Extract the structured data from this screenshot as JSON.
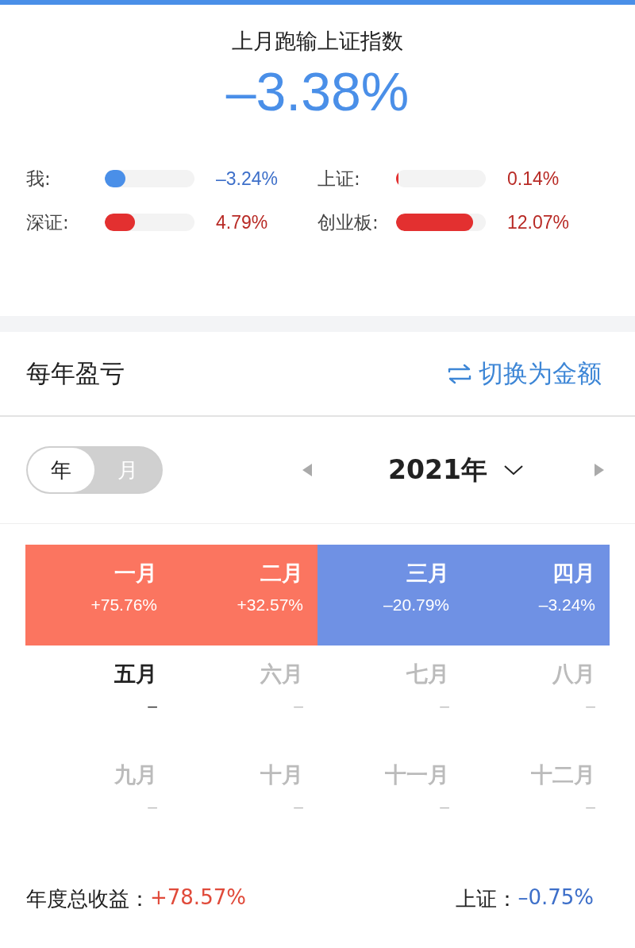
{
  "summary": {
    "title": "上月跑输上证指数",
    "value": "–3.38%"
  },
  "comparisons": [
    {
      "label": "我:",
      "level": 0.23,
      "color": "#4a8fe8",
      "reading": "–3.24%",
      "kind": "loss"
    },
    {
      "label": "上证:",
      "level": 0.02,
      "color": "#e33030",
      "reading": "0.14%",
      "kind": "gain"
    },
    {
      "label": "深证:",
      "level": 0.34,
      "color": "#e33030",
      "reading": "4.79%",
      "kind": "gain"
    },
    {
      "label": "创业板:",
      "level": 0.86,
      "color": "#e33030",
      "reading": "12.07%",
      "kind": "gain"
    }
  ],
  "section": {
    "title": "每年盈亏",
    "switch_label": "切换为金额"
  },
  "period_toggle": [
    {
      "label": "年",
      "selected": true
    },
    {
      "label": "月",
      "selected": false
    }
  ],
  "year_picker": {
    "label": "2021年"
  },
  "months": [
    {
      "name": "一月",
      "value": "+75.76%",
      "kind": "gain"
    },
    {
      "name": "二月",
      "value": "+32.57%",
      "kind": "gain"
    },
    {
      "name": "三月",
      "value": "–20.79%",
      "kind": "loss"
    },
    {
      "name": "四月",
      "value": "–3.24%",
      "kind": "loss"
    },
    {
      "name": "五月",
      "value": "–",
      "kind": "current"
    },
    {
      "name": "六月",
      "value": "–",
      "kind": "future"
    },
    {
      "name": "七月",
      "value": "–",
      "kind": "future"
    },
    {
      "name": "八月",
      "value": "–",
      "kind": "future"
    },
    {
      "name": "九月",
      "value": "–",
      "kind": "future"
    },
    {
      "name": "十月",
      "value": "–",
      "kind": "future"
    },
    {
      "name": "十一月",
      "value": "–",
      "kind": "future"
    },
    {
      "name": "十二月",
      "value": "–",
      "kind": "future"
    }
  ],
  "footer": {
    "total_label": "年度总收益：",
    "total_value": "+78.57%",
    "index_label": "上证：",
    "index_value": "–0.75%"
  }
}
